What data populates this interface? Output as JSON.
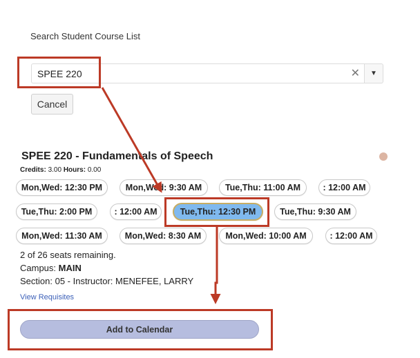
{
  "search": {
    "label": "Search Student Course List",
    "value": "SPEE 220",
    "clear_glyph": "✕",
    "dropdown_glyph": "▼",
    "cancel_label": "Cancel"
  },
  "course": {
    "title": "SPEE 220 - Fundamentals of Speech",
    "credits_label": "Credits:",
    "credits_value": "3.00",
    "hours_label": "Hours:",
    "hours_value": "0.00",
    "sections": [
      "Mon,Wed: 12:30 PM",
      "Mon,Wed: 9:30 AM",
      "Tue,Thu: 11:00 AM",
      ": 12:00 AM",
      "Tue,Thu: 2:00 PM",
      ": 12:00 AM",
      "Tue,Thu: 12:30 PM",
      "Tue,Thu: 9:30 AM",
      "Mon,Wed: 11:30 AM",
      "Mon,Wed: 8:30 AM",
      "Mon,Wed: 10:00 AM",
      ": 12:00 AM"
    ],
    "selected_section_index": 6,
    "seats_text": "2 of 26 seats remaining.",
    "campus_label": "Campus:",
    "campus_value": "MAIN",
    "section_text": "Section: 05 - Instructor: MENEFEE, LARRY",
    "requisites_link": "View Requisites",
    "add_button": "Add to Calendar"
  },
  "colors": {
    "annotation": "#bc3a26",
    "selected_pill": "#7fb9ee",
    "add_button": "#b6bddf",
    "link": "#3b5fb8"
  }
}
